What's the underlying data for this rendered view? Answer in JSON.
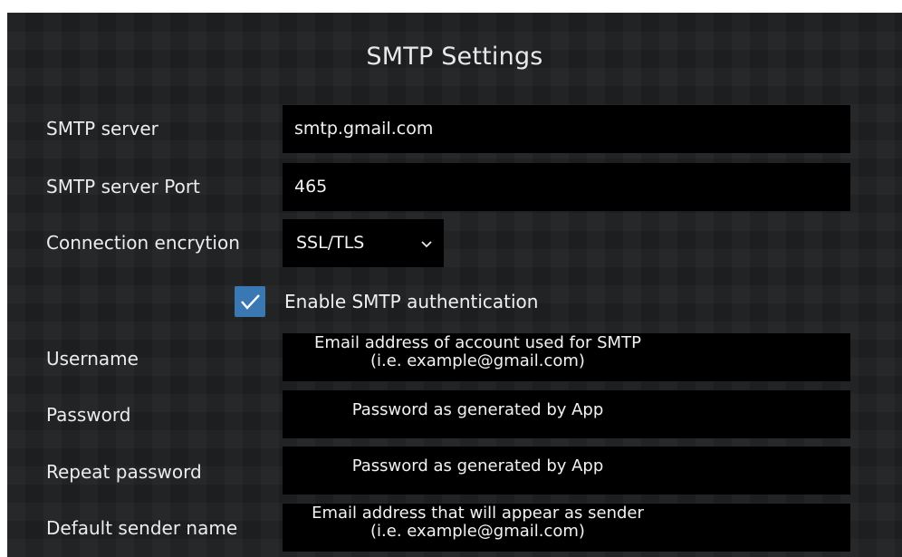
{
  "dialog": {
    "title": "SMTP Settings"
  },
  "fields": {
    "smtp_server": {
      "label": "SMTP server",
      "value": "smtp.gmail.com"
    },
    "smtp_port": {
      "label": "SMTP server Port",
      "value": "465"
    },
    "encryption": {
      "label": "Connection encrytion",
      "value": "SSL/TLS",
      "icon": "chevron-down-icon"
    },
    "auth": {
      "label": "Enable SMTP authentication",
      "checked": true,
      "icon": "checkmark-icon"
    },
    "username": {
      "label": "Username",
      "hint_line1": "Email address of account used for SMTP",
      "hint_line2": "(i.e. example@gmail.com)"
    },
    "password": {
      "label": "Password",
      "hint": "Password as generated by App"
    },
    "repeat_password": {
      "label": "Repeat password",
      "hint": "Password as generated by App"
    },
    "sender_name": {
      "label": "Default sender name",
      "hint_line1": "Email address that will appear as sender",
      "hint_line2": "(i.e. example@gmail.com)"
    }
  },
  "colors": {
    "background": "#1f2021",
    "field_background": "#000000",
    "checkbox_accent": "#3a78b4",
    "text": "#ececec"
  }
}
